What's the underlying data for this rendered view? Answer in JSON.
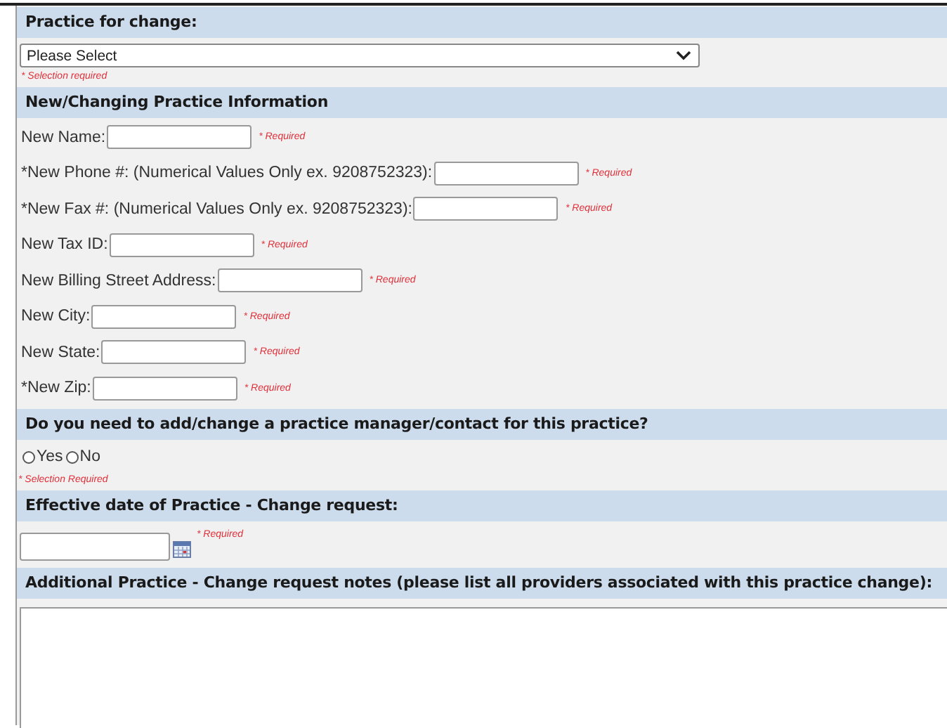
{
  "sections": [
    {
      "title": "Practice for change:",
      "kind": "select",
      "value": "Please Select",
      "note": "* Selection required"
    },
    {
      "title": "New/Changing Practice Information",
      "kind": "fields",
      "fields": [
        {
          "label": "New Name:",
          "note": "* Required"
        },
        {
          "label": "*New Phone #: (Numerical Values Only ex. 9208752323):",
          "note": "* Required"
        },
        {
          "label": "*New Fax #: (Numerical Values Only ex. 9208752323):",
          "note": "* Required"
        },
        {
          "label": "New Tax ID:",
          "note": "* Required"
        },
        {
          "label": "New Billing Street Address:",
          "note": "* Required"
        },
        {
          "label": "New City:",
          "note": "* Required"
        },
        {
          "label": "New State:",
          "note": "* Required"
        },
        {
          "label": "*New Zip:",
          "note": "* Required"
        }
      ]
    },
    {
      "title": "Do you need to add/change a practice manager/contact for this practice?",
      "kind": "radio",
      "options": [
        {
          "label": "Yes",
          "selected": false
        },
        {
          "label": "No",
          "selected": false
        }
      ],
      "note": "* Selection Required"
    },
    {
      "title": "Effective date of Practice - Change request:",
      "kind": "date",
      "note": "* Required"
    },
    {
      "title": "Additional Practice - Change request notes (please list all providers associated with this practice change):",
      "kind": "textarea"
    }
  ]
}
